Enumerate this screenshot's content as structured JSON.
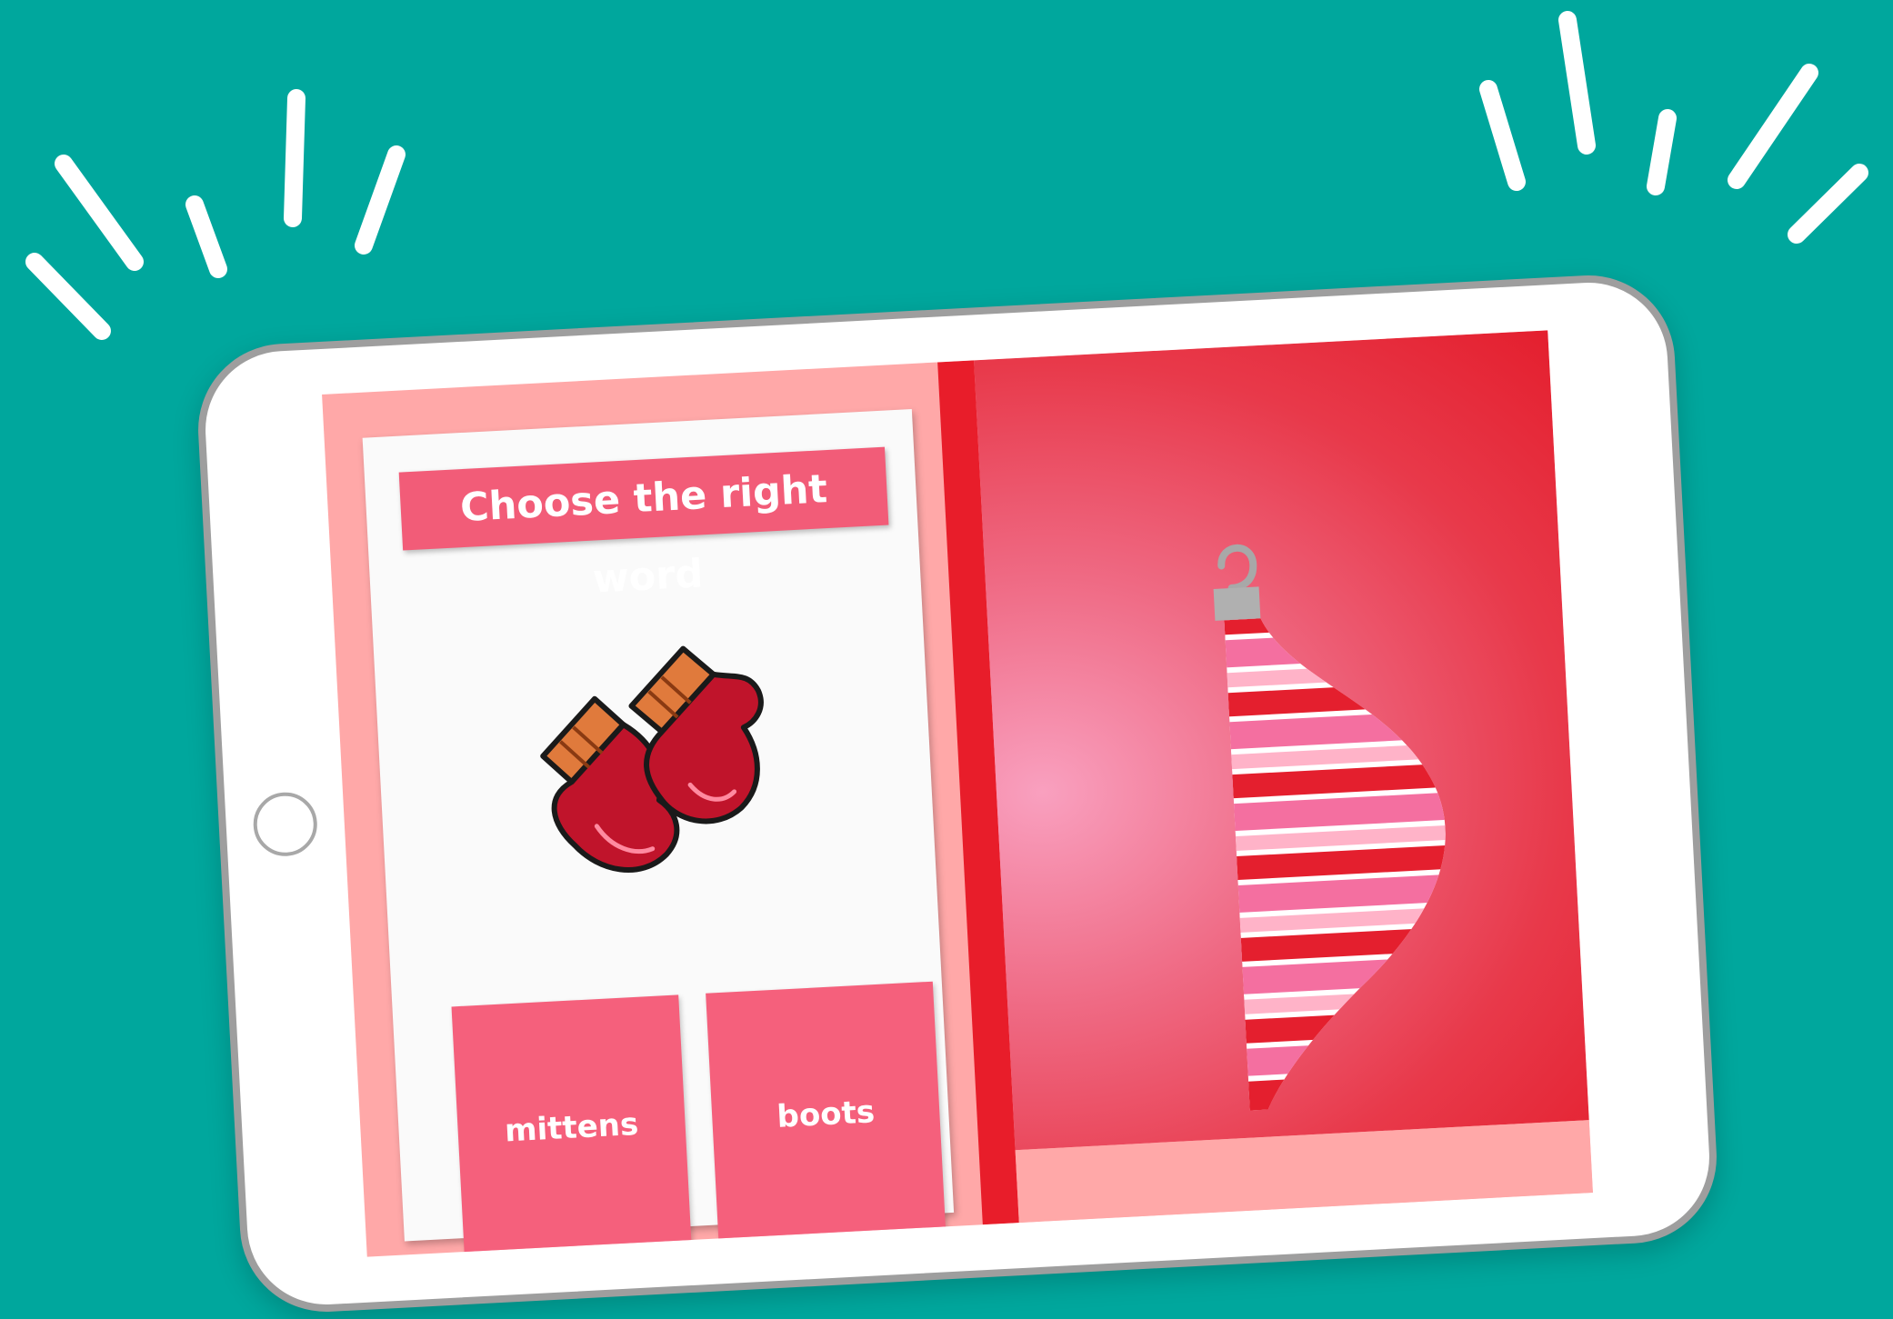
{
  "colors": {
    "background": "#00a79d",
    "title_banner": "#f25c78",
    "answer_button": "#f5607c",
    "screen_background": "#ffa8a8",
    "divider": "#e81d2a"
  },
  "activity": {
    "title": "Choose the right word",
    "picture_icon": "mittens-icon",
    "choices": [
      {
        "label": "mittens"
      },
      {
        "label": "boots"
      }
    ]
  },
  "ornament": {
    "icon": "striped-ornament-half-icon"
  }
}
